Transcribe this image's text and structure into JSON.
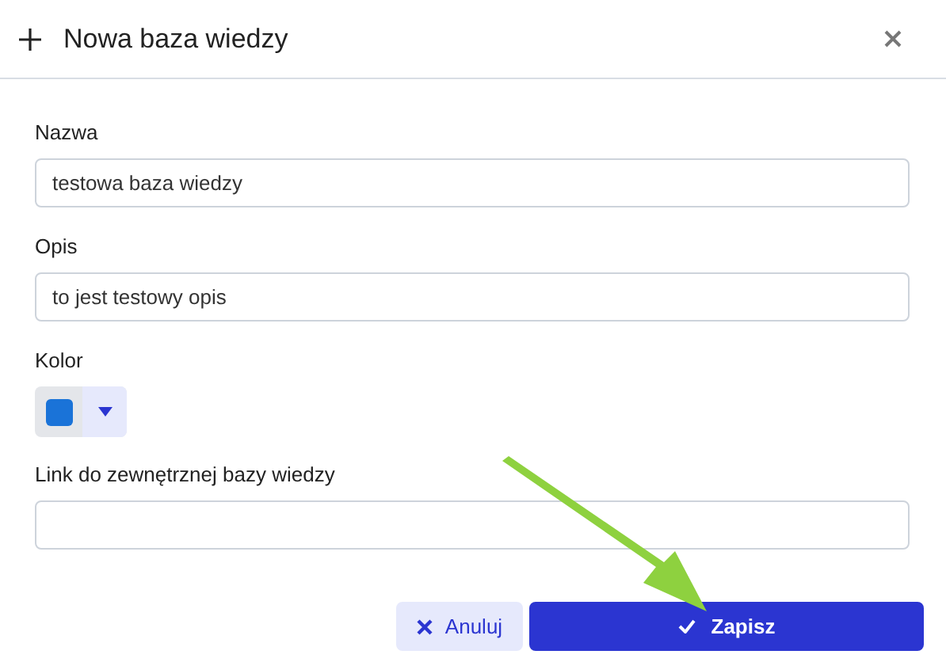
{
  "dialog": {
    "title": "Nowa baza wiedzy"
  },
  "fields": [
    {
      "kind": "text",
      "label": "Nazwa",
      "value": "testowa baza wiedzy"
    },
    {
      "kind": "text",
      "label": "Opis",
      "value": "to jest testowy opis"
    },
    {
      "kind": "color",
      "label": "Kolor",
      "color": "#1a73d8"
    },
    {
      "kind": "text",
      "label": "Link do zewnętrznej bazy wiedzy"
    }
  ],
  "buttons": [
    {
      "kind": "cancel",
      "label": "Anuluj"
    },
    {
      "kind": "save",
      "label": "Zapisz"
    }
  ]
}
